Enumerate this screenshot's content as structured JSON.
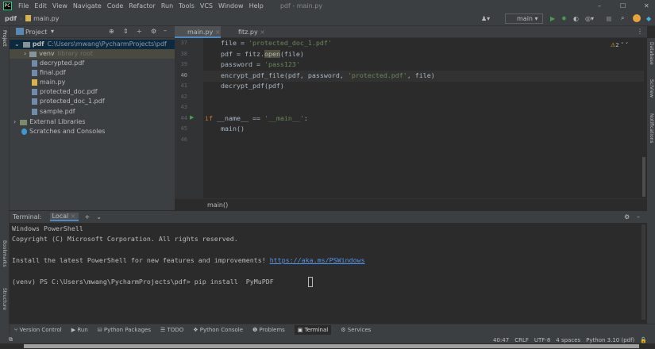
{
  "menu": {
    "items": [
      "File",
      "Edit",
      "View",
      "Navigate",
      "Code",
      "Refactor",
      "Run",
      "Tools",
      "VCS",
      "Window",
      "Help"
    ],
    "title": "pdf - main.py"
  },
  "nav": {
    "project": "pdf",
    "file": "main.py",
    "run_config": "main"
  },
  "project_panel": {
    "label": "Project",
    "root": "pdf",
    "root_path": "C:\\Users\\mwang\\PycharmProjects\\pdf",
    "venv": "venv",
    "venv_note": "library root",
    "files": [
      "decrypted.pdf",
      "final.pdf",
      "main.py",
      "protected_doc.pdf",
      "protected_doc_1.pdf",
      "sample.pdf"
    ],
    "external": "External Libraries",
    "scratches": "Scratches and Consoles"
  },
  "tabs": [
    "main.py",
    "fitz.py"
  ],
  "editor": {
    "warnings": "2",
    "line_numbers": [
      "37",
      "38",
      "39",
      "40",
      "41",
      "42",
      "43",
      "44",
      "45",
      "46"
    ],
    "breadcrumb": "main()"
  },
  "side_tools": {
    "left": [
      "Project",
      "Bookmarks",
      "Structure"
    ],
    "right": [
      "Database",
      "SciView",
      "Notifications"
    ]
  },
  "terminal": {
    "label": "Terminal:",
    "tab": "Local",
    "lines": [
      "Windows PowerShell",
      "Copyright (C) Microsoft Corporation. All rights reserved.",
      "Install the latest PowerShell for new features and improvements! ",
      "(venv) PS C:\\Users\\mwang\\PycharmProjects\\pdf> "
    ],
    "link": "https://aka.ms/PSWindows",
    "command": "pip install  PyMuPDF"
  },
  "bottom_tools": [
    "Version Control",
    "Run",
    "Python Packages",
    "TODO",
    "Python Console",
    "Problems",
    "Terminal",
    "Services"
  ],
  "status": {
    "position": "40:47",
    "line_sep": "CRLF",
    "encoding": "UTF-8",
    "indent": "4 spaces",
    "interpreter": "Python 3.10 (pdf)"
  },
  "code": {
    "l37a": "file = ",
    "l37s": "'protected_doc_1.pdf'",
    "l38a": "pdf = fitz.",
    "l38b": "open",
    "l38c": "(file)",
    "l39a": "password = ",
    "l39s": "'pass123'",
    "l40a": "encrypt_pdf_file(pdf, password, ",
    "l40s": "'protected.pdf'",
    "l40b": ", file)",
    "l41": "decrypt_pdf(pdf)",
    "l44k": "if",
    "l44a": " __name__ == ",
    "l44s": "'__main__'",
    "l44b": ":",
    "l45": "main()"
  }
}
